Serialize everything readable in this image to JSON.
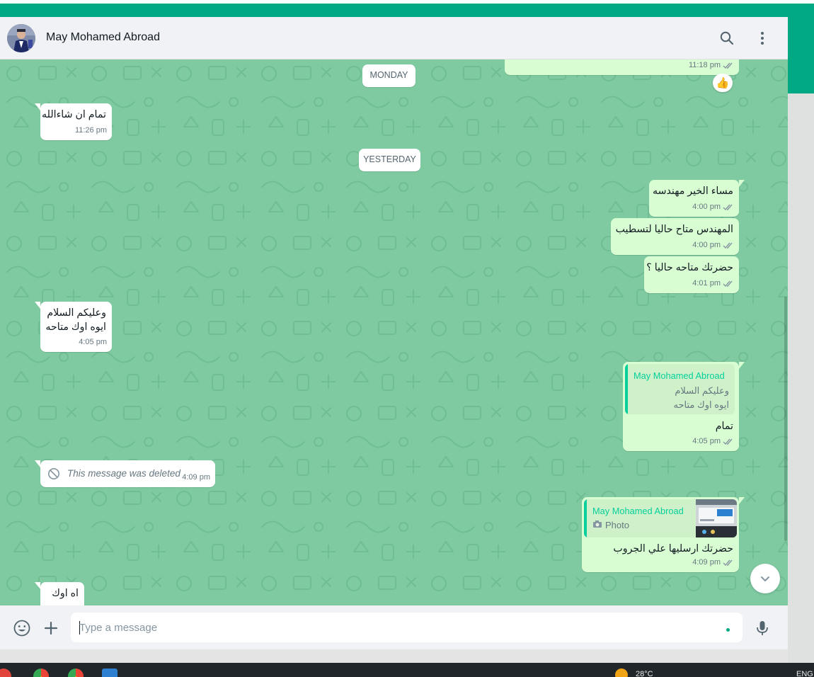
{
  "header": {
    "contact_name": "May Mohamed Abroad",
    "search_icon": "search-icon",
    "menu_icon": "kebab-menu-icon"
  },
  "chat": {
    "date_dividers": [
      "MONDAY",
      "YESTERDAY"
    ],
    "messages": [
      {
        "dir": "out",
        "text": "",
        "time": "11:18 pm",
        "reaction": "👍"
      },
      {
        "dir": "in",
        "text": "تمام ان شاءالله",
        "time": "11:26 pm"
      },
      {
        "dir": "out",
        "text": "مساء الخير مهندسه",
        "time": "4:00 pm"
      },
      {
        "dir": "out",
        "text": "المهندس متاح حاليا لتسطيب",
        "time": "4:00 pm"
      },
      {
        "dir": "out",
        "text": "حضرتك متاحه حاليا ؟",
        "time": "4:01 pm"
      },
      {
        "dir": "in",
        "lines": [
          "وعليكم السلام",
          "ايوه اوك متاحه"
        ],
        "time": "4:05 pm"
      },
      {
        "dir": "out",
        "quote": {
          "name": "May Mohamed Abroad",
          "lines": [
            "وعليكم السلام",
            "ايوه اوك متاحه"
          ]
        },
        "text": "تمام",
        "time": "4:05 pm"
      },
      {
        "dir": "in",
        "deleted": true,
        "text": "This message was deleted",
        "time": "4:09 pm"
      },
      {
        "dir": "out",
        "quote": {
          "name": "May Mohamed Abroad",
          "photo_label": "Photo"
        },
        "text": "حضرتك ارسليها علي الجروب",
        "time": "4:09 pm"
      },
      {
        "dir": "in",
        "text": "اه اوك"
      }
    ]
  },
  "composer": {
    "placeholder": "Type a message",
    "emoji_icon": "emoji-icon",
    "attach_icon": "plus-icon",
    "mic_icon": "microphone-icon"
  },
  "taskbar": {
    "weather": "28°C",
    "language": "ENG"
  },
  "colors": {
    "brand_green": "#00a884",
    "chat_wallpaper": "#7fcaa1",
    "outgoing_bubble": "#d9fdd3",
    "incoming_bubble": "#ffffff",
    "read_ticks": "#8696a0",
    "quote_accent": "#06cf9c"
  }
}
